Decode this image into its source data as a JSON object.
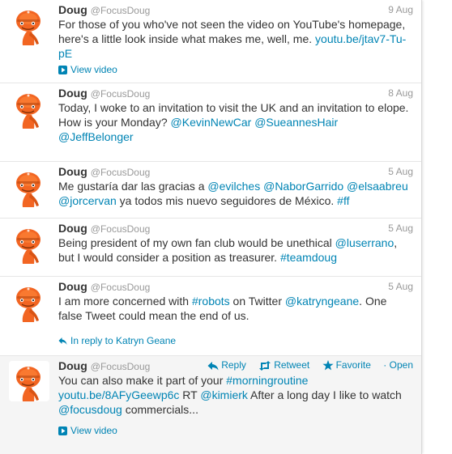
{
  "tweets": [
    {
      "fullname": "Doug",
      "username": "@FocusDoug",
      "time": "9 Aug",
      "segments": [
        {
          "text": "For those of you who've not seen the video on YouTube's homepage, here's a little look inside what makes me, well, me. ",
          "link": false
        },
        {
          "text": "youtu.be/jtav7-Tu-pE",
          "link": true
        }
      ],
      "context": {
        "icon": "video-play-icon",
        "label": "View video"
      }
    },
    {
      "fullname": "Doug",
      "username": "@FocusDoug",
      "time": "8 Aug",
      "segments": [
        {
          "text": "Today, I woke to an invitation to visit the UK and an invitation to elope. How is your Monday? ",
          "link": false
        },
        {
          "text": "@KevinNewCar",
          "link": true
        },
        {
          "text": " ",
          "link": false
        },
        {
          "text": "@SueannesHair",
          "link": true
        },
        {
          "text": " ",
          "link": false
        },
        {
          "text": "@JeffBelonger",
          "link": true
        }
      ]
    },
    {
      "fullname": "Doug",
      "username": "@FocusDoug",
      "time": "5 Aug",
      "segments": [
        {
          "text": "Me gustaría dar las gracias a ",
          "link": false
        },
        {
          "text": "@evilches",
          "link": true
        },
        {
          "text": " ",
          "link": false
        },
        {
          "text": "@NaborGarrido",
          "link": true
        },
        {
          "text": " ",
          "link": false
        },
        {
          "text": "@elsaabreu",
          "link": true
        },
        {
          "text": " ",
          "link": false
        },
        {
          "text": "@jorcervan",
          "link": true
        },
        {
          "text": " ya todos mis nuevo seguidores de México. ",
          "link": false
        },
        {
          "text": "#ff",
          "link": true
        }
      ]
    },
    {
      "fullname": "Doug",
      "username": "@FocusDoug",
      "time": "5 Aug",
      "segments": [
        {
          "text": "Being president of my own fan club would be unethical ",
          "link": false
        },
        {
          "text": "@luserrano",
          "link": true
        },
        {
          "text": ", but I would consider a position as treasurer. ",
          "link": false
        },
        {
          "text": "#teamdoug",
          "link": true
        }
      ]
    },
    {
      "fullname": "Doug",
      "username": "@FocusDoug",
      "time": "5 Aug",
      "segments": [
        {
          "text": "I am more concerned with ",
          "link": false
        },
        {
          "text": "#robots",
          "link": true
        },
        {
          "text": " on Twitter ",
          "link": false
        },
        {
          "text": "@katryngeane",
          "link": true
        },
        {
          "text": ". One false Tweet could mean the end of us.",
          "link": false
        }
      ],
      "context": {
        "icon": "reply-arrow-icon",
        "label": "In reply to Katryn Geane"
      }
    },
    {
      "fullname": "Doug",
      "username": "@FocusDoug",
      "time": "",
      "segments": [
        {
          "text": "You can also make it part of your ",
          "link": false
        },
        {
          "text": "#morningroutine",
          "link": true
        },
        {
          "text": " ",
          "link": false
        },
        {
          "text": "youtu.be/8AFyGeewp6c",
          "link": true
        },
        {
          "text": " RT ",
          "link": false
        },
        {
          "text": "@kimierk",
          "link": true
        },
        {
          "text": " After a long day I like to watch ",
          "link": false
        },
        {
          "text": "@focusdoug",
          "link": true
        },
        {
          "text": " commercials...",
          "link": false
        }
      ],
      "context": {
        "icon": "video-play-icon",
        "label": "View video"
      },
      "actions": {
        "reply": "Reply",
        "retweet": "Retweet",
        "favorite": "Favorite",
        "open": "Open"
      }
    }
  ],
  "colors": {
    "link": "#0084b4",
    "text": "#333333",
    "muted": "#999999",
    "avatar": "#f26522"
  }
}
